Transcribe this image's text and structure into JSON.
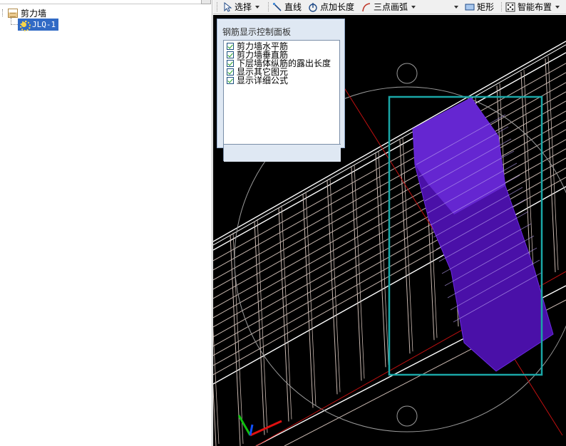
{
  "tree": {
    "root_label": "剪力墙",
    "child_label": "JLQ-1"
  },
  "toolbar": {
    "select_label": "选择",
    "line_label": "直线",
    "point_length_label": "点加长度",
    "three_point_arc_label": "三点画弧",
    "rectangle_label": "矩形",
    "smart_layout_label": "智能布置"
  },
  "rebar_panel": {
    "title": "钢筋显示控制面板",
    "options": [
      {
        "label": "剪力墙水平筋",
        "checked": true
      },
      {
        "label": "剪力墙垂直筋",
        "checked": true
      },
      {
        "label": "下层墙体纵筋的露出长度",
        "checked": true
      },
      {
        "label": "显示其它图元",
        "checked": true
      },
      {
        "label": "显示详细公式",
        "checked": true
      }
    ]
  },
  "colors": {
    "viewport_bg": "#000000",
    "selection_box": "#1aa6a6",
    "solid_element": "#5a1fc8",
    "rebar_lines": "#c9b8b0",
    "axis_x": "#e01010",
    "axis_y": "#10c010",
    "axis_z": "#1050ff",
    "tree_selection": "#316ac5"
  }
}
